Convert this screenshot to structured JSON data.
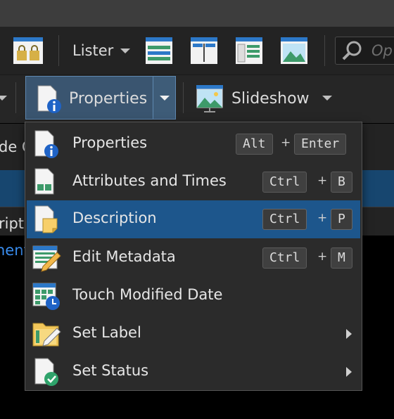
{
  "toolbar": {
    "lister_label": "Lister",
    "search_placeholder": "Op",
    "properties_label": "Properties",
    "slideshow_label": "Slideshow"
  },
  "background": {
    "row1_text": "de C",
    "row3_text": "ript",
    "row4_text": "nent"
  },
  "menu": {
    "items": [
      {
        "label": "Properties",
        "keys": [
          "Alt",
          "Enter"
        ],
        "icon": "properties-icon"
      },
      {
        "label": "Attributes and Times",
        "keys": [
          "Ctrl",
          "B"
        ],
        "icon": "attributes-icon"
      },
      {
        "label": "Description",
        "keys": [
          "Ctrl",
          "P"
        ],
        "icon": "description-icon",
        "selected": true
      },
      {
        "label": "Edit Metadata",
        "keys": [
          "Ctrl",
          "M"
        ],
        "icon": "edit-metadata-icon"
      },
      {
        "label": "Touch Modified Date",
        "icon": "touch-date-icon"
      },
      {
        "label": "Set Label",
        "icon": "set-label-icon",
        "submenu": true
      },
      {
        "label": "Set Status",
        "icon": "set-status-icon",
        "submenu": true
      }
    ],
    "plus_sign": "+"
  },
  "colors": {
    "selection": "#1d568c",
    "menu_bg": "#2b2b2b",
    "accent_blue": "#1f63c6",
    "status_green": "#2fa36b"
  }
}
